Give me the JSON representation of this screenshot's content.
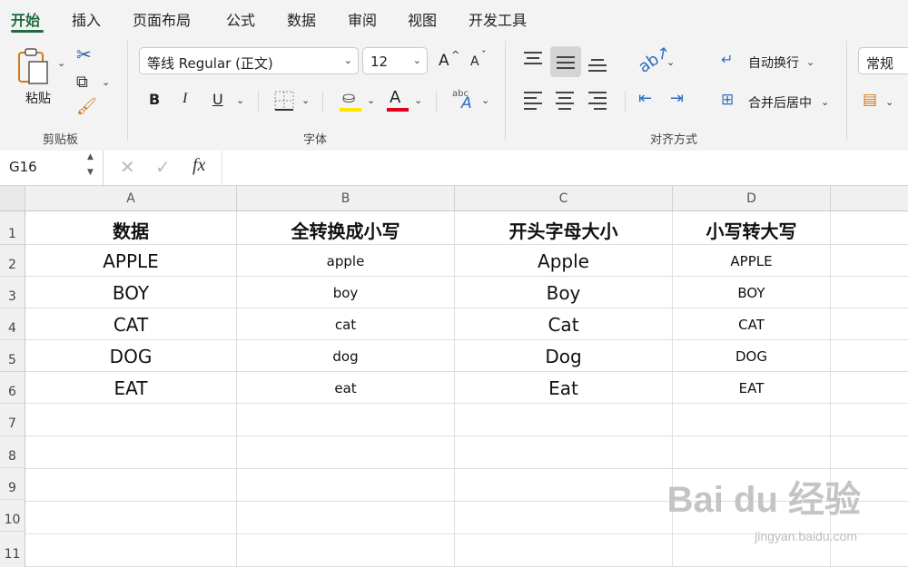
{
  "tabs": [
    "开始",
    "插入",
    "页面布局",
    "公式",
    "数据",
    "审阅",
    "视图",
    "开发工具"
  ],
  "clipboard": {
    "paste_label": "粘贴",
    "group_label": "剪贴板"
  },
  "font": {
    "name": "等线 Regular (正文)",
    "size": "12",
    "group_label": "字体",
    "bold": "B",
    "italic": "I",
    "underline": "U",
    "font_color_letter": "A",
    "grow": "A",
    "shrink": "A"
  },
  "alignment": {
    "wrap_text": "自动换行",
    "merge_center": "合并后居中",
    "group_label": "对齐方式"
  },
  "number": {
    "format": "常规"
  },
  "formula_bar": {
    "cell_ref": "G16",
    "fx": "fx",
    "cancel": "✕",
    "confirm": "✓"
  },
  "sheet": {
    "columns": [
      "A",
      "B",
      "C",
      "D"
    ],
    "rows": [
      "1",
      "2",
      "3",
      "4",
      "5",
      "6",
      "7",
      "8",
      "9",
      "10",
      "11"
    ],
    "headers": [
      "数据",
      "全转换成小写",
      "开头字母大小",
      "小写转大写"
    ],
    "data": [
      [
        "APPLE",
        "apple",
        "Apple",
        "APPLE"
      ],
      [
        "BOY",
        "boy",
        "Boy",
        "BOY"
      ],
      [
        "CAT",
        "cat",
        "Cat",
        "CAT"
      ],
      [
        "DOG",
        "dog",
        "Dog",
        "DOG"
      ],
      [
        "EAT",
        "eat",
        "Eat",
        "EAT"
      ]
    ]
  },
  "watermark": {
    "main": "Bai du 经验",
    "sub": "jingyan.baidu.com"
  },
  "colors": {
    "accent": "#1d6b3f",
    "highlight_yellow": "#ffe600",
    "font_red": "#e0001b"
  }
}
